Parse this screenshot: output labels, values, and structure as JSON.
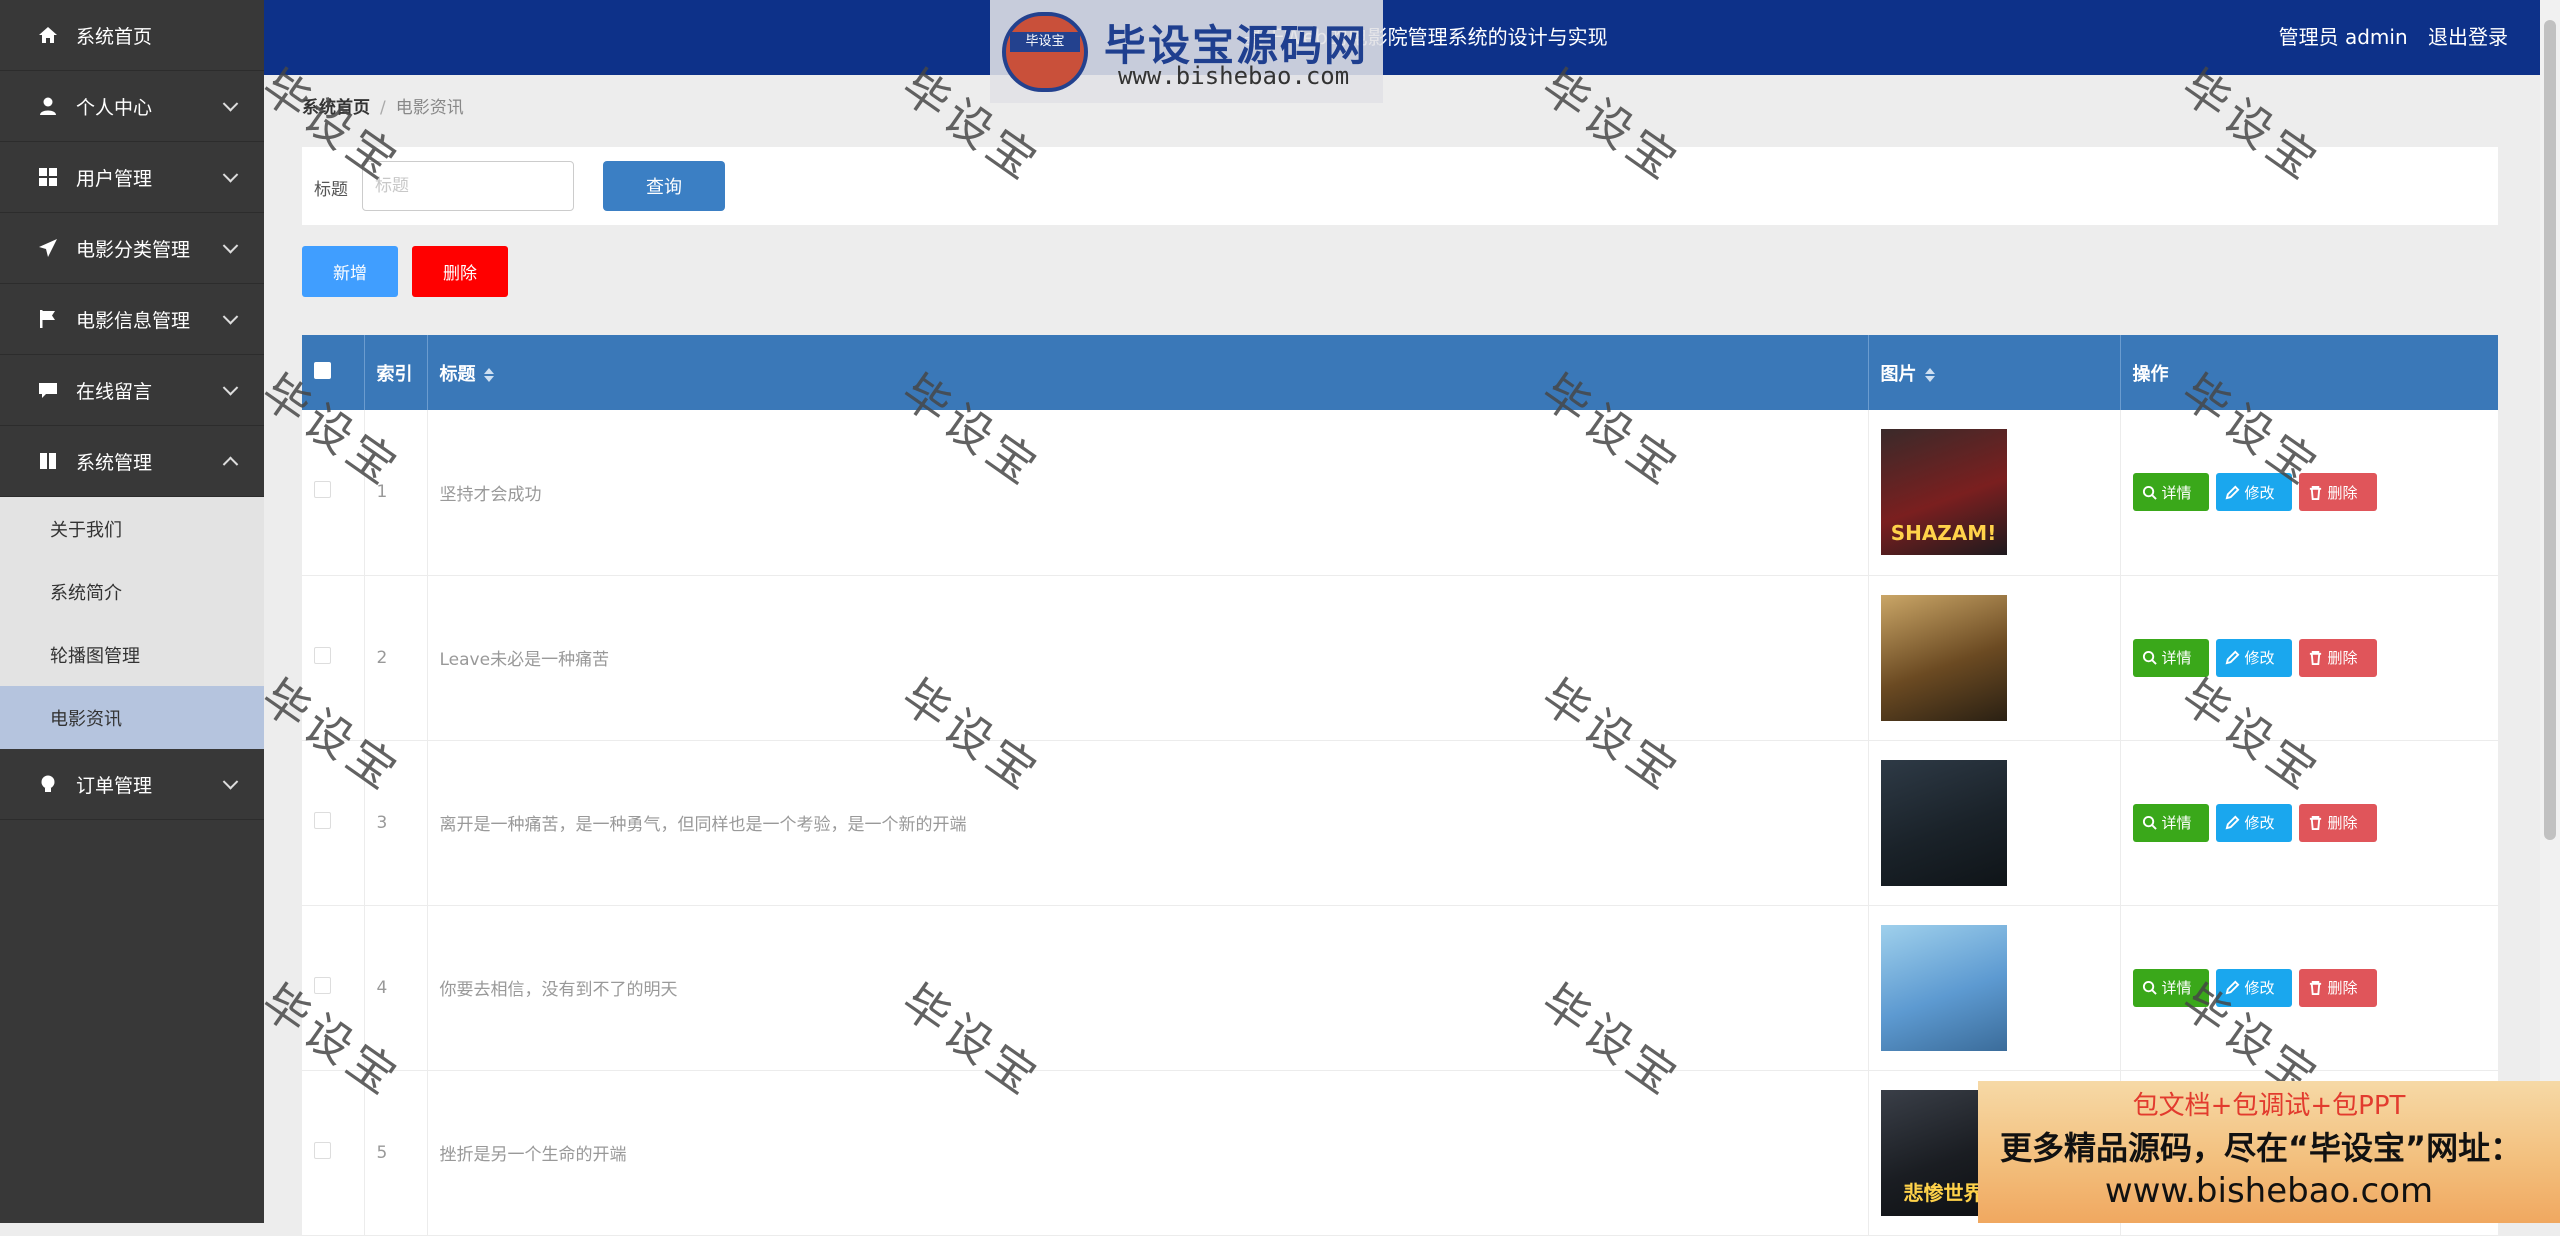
{
  "header": {
    "title": "基于Web的电影院管理系统的设计与实现",
    "user_label": "管理员 admin",
    "logout": "退出登录"
  },
  "logo": {
    "badge": "毕设宝",
    "name": "毕设宝源码网",
    "url": "www.bishebao.com"
  },
  "sidebar": {
    "items": [
      {
        "label": "系统首页",
        "icon": "home-icon"
      },
      {
        "label": "个人中心",
        "icon": "user-icon"
      },
      {
        "label": "用户管理",
        "icon": "grid-icon"
      },
      {
        "label": "电影分类管理",
        "icon": "paper-plane-icon"
      },
      {
        "label": "电影信息管理",
        "icon": "flag-icon"
      },
      {
        "label": "在线留言",
        "icon": "comment-icon"
      },
      {
        "label": "系统管理",
        "icon": "book-icon"
      },
      {
        "label": "订单管理",
        "icon": "lightbulb-icon"
      }
    ],
    "submenu": [
      "关于我们",
      "系统简介",
      "轮播图管理",
      "电影资讯"
    ]
  },
  "breadcrumb": {
    "home": "系统首页",
    "current": "电影资讯"
  },
  "search": {
    "label": "标题",
    "placeholder": "标题",
    "button": "查询"
  },
  "actions": {
    "add": "新增",
    "delete": "删除"
  },
  "table": {
    "headers": [
      "索引",
      "标题",
      "图片",
      "操作"
    ],
    "op_detail": "详情",
    "op_edit": "修改",
    "op_delete": "删除",
    "rows": [
      {
        "index": "1",
        "title": "坚持才会成功",
        "poster_text": "SHAZAM!",
        "poster_colors": [
          "#3a2a2a",
          "#7a1f1f",
          "#1e1a1e"
        ]
      },
      {
        "index": "2",
        "title": "Leave未必是一种痛苦",
        "poster_text": "",
        "poster_colors": [
          "#caa667",
          "#6b4a22",
          "#2a2013"
        ]
      },
      {
        "index": "3",
        "title": "离开是一种痛苦，是一种勇气，但同样也是一个考验，是一个新的开端",
        "poster_text": "",
        "poster_colors": [
          "#2e3a46",
          "#1a2229",
          "#0f1418"
        ]
      },
      {
        "index": "4",
        "title": "你要去相信，没有到不了的明天",
        "poster_text": "",
        "poster_colors": [
          "#9fd0ec",
          "#5d9ad1",
          "#3b6c9a"
        ]
      },
      {
        "index": "5",
        "title": "挫折是另一个生命的开端",
        "poster_text": "悲惨世界",
        "poster_colors": [
          "#3a3f48",
          "#1a1d22",
          "#0d0f12"
        ]
      }
    ]
  },
  "watermark": "毕设宝",
  "ad": {
    "line1": "包文档+包调试+包PPT",
    "line2": "更多精品源码，尽在“毕设宝”网址：",
    "line3": "www.bishebao.com"
  }
}
